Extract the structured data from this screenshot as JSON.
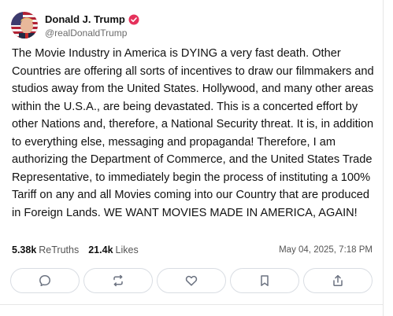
{
  "author": {
    "display_name": "Donald J. Trump",
    "handle": "@realDonaldTrump",
    "verified": true,
    "avatar_icon": "avatar-flag-icon"
  },
  "post": {
    "text": "The Movie Industry in America is DYING a very fast death. Other Countries are offering all sorts of incentives to draw our filmmakers and studios away from the United States. Hollywood, and many other areas within the U.S.A., are being devastated. This is a concerted effort by other Nations and, therefore, a National Security threat. It is, in addition to everything else, messaging and propaganda! Therefore, I am authorizing the Department of Commerce, and the United States Trade Representative, to immediately begin the process of instituting a 100% Tariff on any and all Movies coming into our Country that are produced in Foreign Lands. WE WANT MOVIES MADE IN AMERICA, AGAIN!",
    "retruths_count": "5.38k",
    "retruths_label": "ReTruths",
    "likes_count": "21.4k",
    "likes_label": "Likes",
    "timestamp": "May 04, 2025, 7:18 PM"
  },
  "actions": [
    {
      "name": "reply",
      "icon": "reply-icon"
    },
    {
      "name": "retruth",
      "icon": "retruth-icon"
    },
    {
      "name": "like",
      "icon": "heart-icon"
    },
    {
      "name": "bookmark",
      "icon": "bookmark-icon"
    },
    {
      "name": "share",
      "icon": "share-icon"
    }
  ],
  "colors": {
    "verified_badge": "#e5315b",
    "button_border": "#d9dde3",
    "icon_stroke": "#6b7280",
    "muted_text": "#6b6b6b"
  }
}
